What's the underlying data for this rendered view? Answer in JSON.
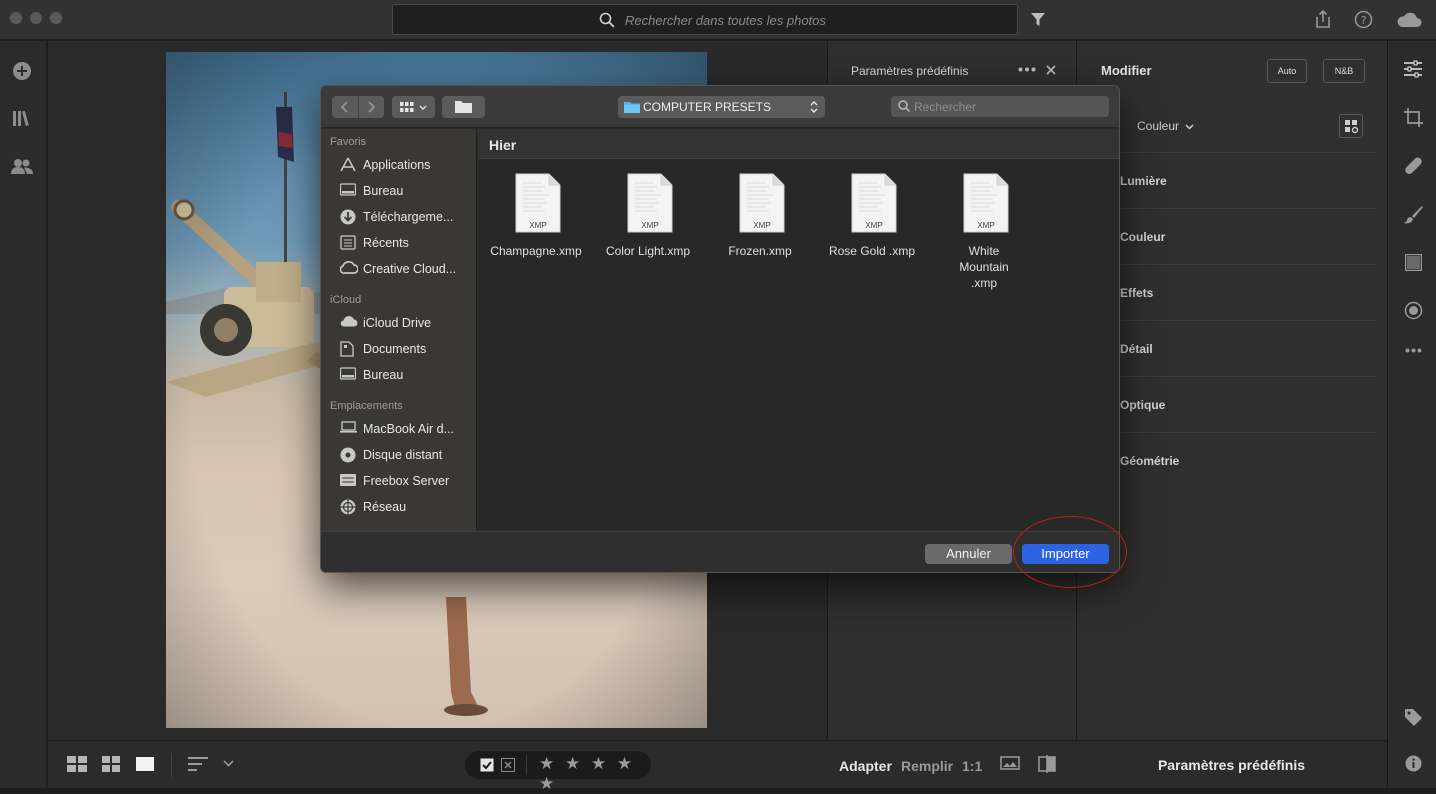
{
  "titlebar": {
    "search_placeholder": "Rechercher dans toutes les photos"
  },
  "presets_panel": {
    "header": "Paramètres prédéfinis",
    "footer_label": "Paramètres prédéfinis"
  },
  "edit_panel": {
    "title": "Modifier",
    "auto_label": "Auto",
    "bw_label": "N&B",
    "profile_label": "Couleur",
    "sections": [
      "Lumière",
      "Couleur",
      "Effets",
      "Détail",
      "Optique",
      "Géométrie"
    ]
  },
  "bottombar": {
    "fit_label": "Adapter",
    "fill_label": "Remplir",
    "ratio_label": "1:1",
    "stars": "★ ★ ★ ★ ★"
  },
  "dialog": {
    "path_label": "COMPUTER PRESETS",
    "search_placeholder": "Rechercher",
    "group_label": "Hier",
    "sidebar": [
      {
        "heading": "Favoris",
        "items": [
          {
            "label": "Applications",
            "icon": "applications-icon"
          },
          {
            "label": "Bureau",
            "icon": "desktop-icon"
          },
          {
            "label": "Téléchargeme...",
            "icon": "downloads-icon"
          },
          {
            "label": "Récents",
            "icon": "recents-icon"
          },
          {
            "label": "Creative Cloud...",
            "icon": "creative-cloud-icon"
          }
        ]
      },
      {
        "heading": "iCloud",
        "items": [
          {
            "label": "iCloud Drive",
            "icon": "icloud-icon"
          },
          {
            "label": "Documents",
            "icon": "documents-icon"
          },
          {
            "label": "Bureau",
            "icon": "desktop-icon"
          }
        ]
      },
      {
        "heading": "Emplacements",
        "items": [
          {
            "label": "MacBook Air d...",
            "icon": "laptop-icon"
          },
          {
            "label": "Disque distant",
            "icon": "disc-icon"
          },
          {
            "label": "Freebox Server",
            "icon": "server-icon"
          },
          {
            "label": "Réseau",
            "icon": "network-icon"
          }
        ]
      }
    ],
    "files": [
      {
        "name": "Champagne.xmp",
        "badge": "XMP"
      },
      {
        "name": "Color Light.xmp",
        "badge": "XMP"
      },
      {
        "name": "Frozen.xmp",
        "badge": "XMP"
      },
      {
        "name": "Rose Gold .xmp",
        "badge": "XMP"
      },
      {
        "name": "White Mountain .xmp",
        "badge": "XMP"
      }
    ],
    "cancel_label": "Annuler",
    "import_label": "Importer"
  },
  "colors": {
    "accent": "#2b63e3",
    "highlight_ring": "#c01d1d"
  }
}
